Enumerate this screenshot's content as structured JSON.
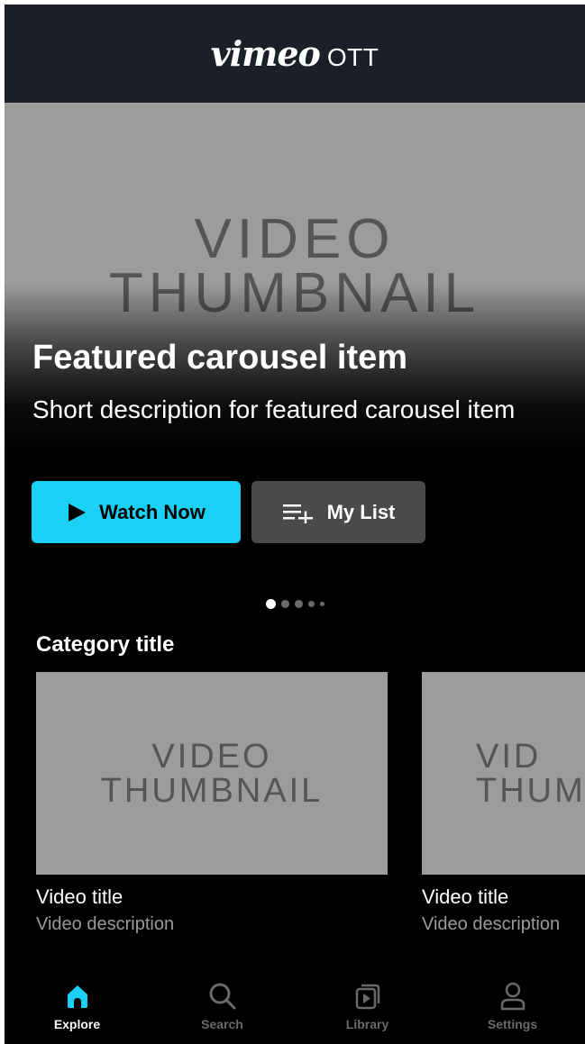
{
  "header": {
    "brand_word": "vimeo",
    "brand_suffix": "OTT"
  },
  "hero": {
    "thumbnail_text_line1": "VIDEO",
    "thumbnail_text_line2": "THUMBNAIL",
    "title": "Featured carousel item",
    "description": "Short description for featured carousel item",
    "watch_label": "Watch Now",
    "mylist_label": "My List",
    "carousel": {
      "total": 5,
      "active_index": 0
    }
  },
  "category": {
    "title": "Category title",
    "items": [
      {
        "thumb_line1": "VIDEO",
        "thumb_line2": "THUMBNAIL",
        "title": "Video title",
        "description": "Video description"
      },
      {
        "thumb_line1": "VID",
        "thumb_line2": "THUM",
        "title": "Video title",
        "description": "Video description"
      }
    ]
  },
  "tabbar": {
    "tabs": [
      {
        "label": "Explore",
        "icon": "home-icon",
        "active": true
      },
      {
        "label": "Search",
        "icon": "search-icon",
        "active": false
      },
      {
        "label": "Library",
        "icon": "library-icon",
        "active": false
      },
      {
        "label": "Settings",
        "icon": "user-icon",
        "active": false
      }
    ]
  },
  "colors": {
    "accent": "#1ad0f5",
    "header_bg": "#1b1f27",
    "thumbnail_bg": "#9c9c9c"
  }
}
